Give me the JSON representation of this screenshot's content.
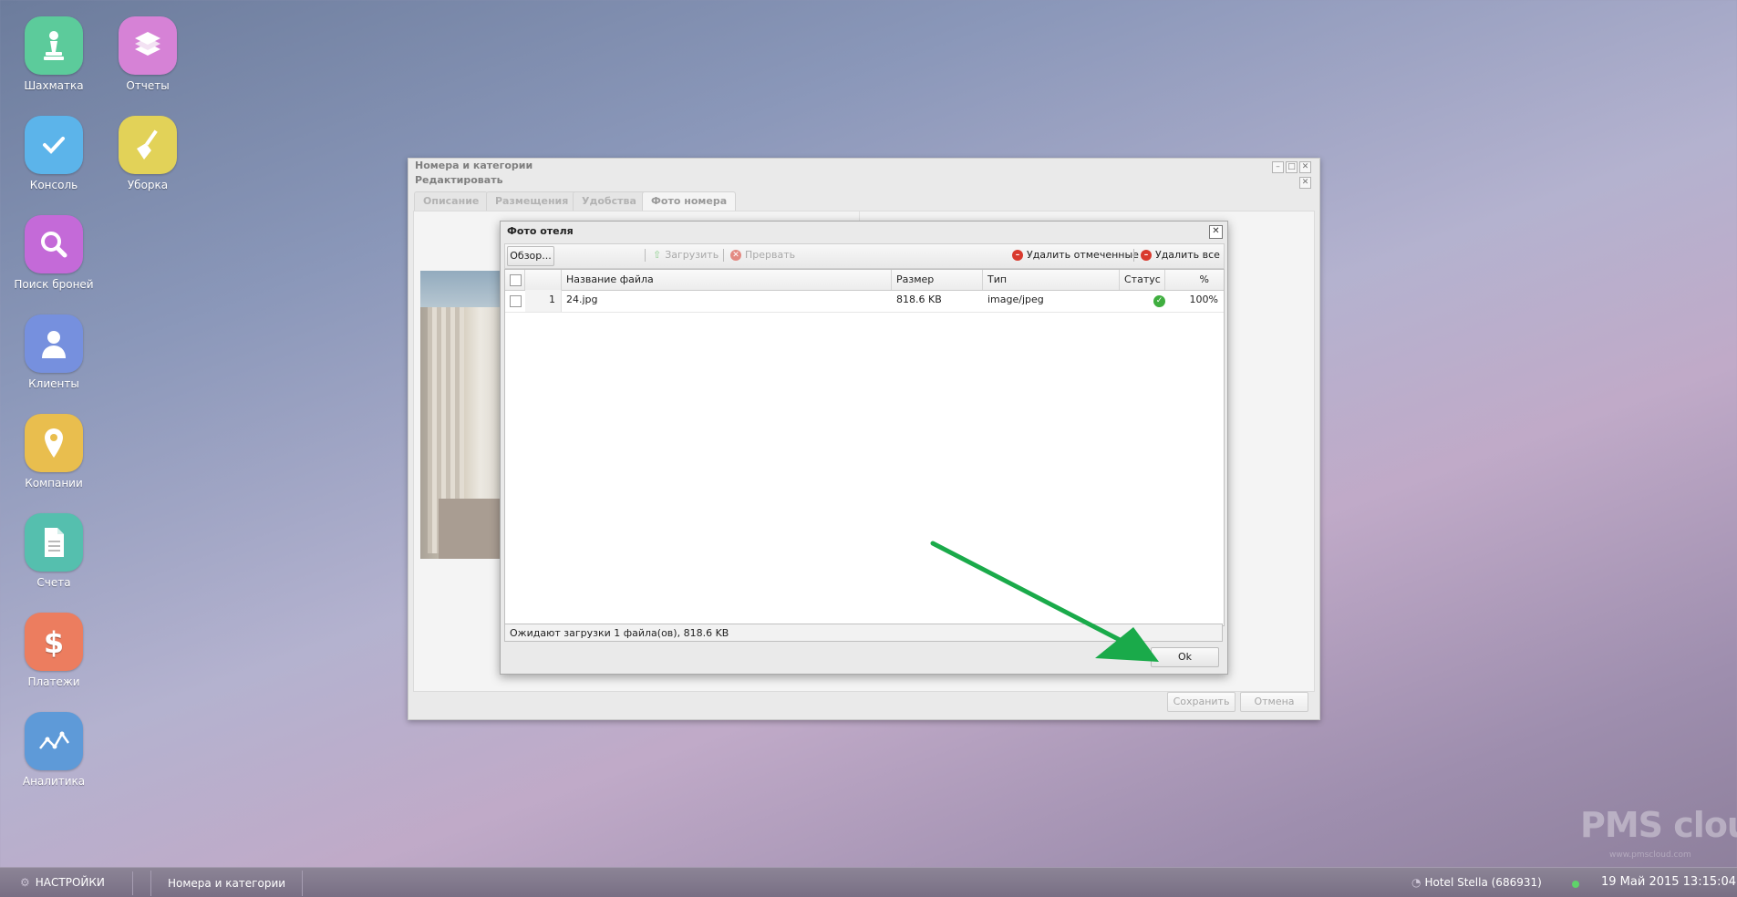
{
  "desktop": {
    "icons": [
      {
        "label": "Шахматка",
        "icon": "chess-pawn-icon",
        "color": "#5ccb9b"
      },
      {
        "label": "Отчеты",
        "icon": "stack-icon",
        "color": "#d682d6"
      },
      {
        "label": "Консоль",
        "icon": "check-icon",
        "color": "#5cb4ea"
      },
      {
        "label": "Уборка",
        "icon": "broom-icon",
        "color": "#e2d258"
      },
      {
        "label": "Поиск броней",
        "icon": "search-icon",
        "color": "#c46ad8"
      },
      {
        "label": "Клиенты",
        "icon": "user-icon",
        "color": "#7690de"
      },
      {
        "label": "Компании",
        "icon": "location-pin-icon",
        "color": "#e9be4e"
      },
      {
        "label": "Счета",
        "icon": "document-icon",
        "color": "#55bfae"
      },
      {
        "label": "Платежи",
        "icon": "dollar-icon",
        "color": "#ec7d5f"
      },
      {
        "label": "Аналитика",
        "icon": "chart-icon",
        "color": "#5e9ad8"
      }
    ]
  },
  "rooms_window": {
    "title": "Номера и категории"
  },
  "edit_window": {
    "title": "Редактировать",
    "tabs": [
      "Описание",
      "Размещения",
      "Удобства",
      "Фото номера"
    ],
    "save_label": "Сохранить",
    "cancel_label": "Отмена"
  },
  "photo_dialog": {
    "title": "Фото отеля",
    "browse_label": "Обзор...",
    "upload_label": "Загрузить",
    "abort_label": "Прервать",
    "delete_checked_label": "Удалить отмеченные",
    "delete_all_label": "Удалить все",
    "columns": [
      "Название файла",
      "Размер",
      "Тип",
      "Статус",
      "%"
    ],
    "rows": [
      {
        "num": "1",
        "name": "24.jpg",
        "size": "818.6 KB",
        "type": "image/jpeg",
        "status": "ok",
        "percent": "100%"
      }
    ],
    "status_text": "Ожидают загрузки 1 файла(ов), 818.6 KB",
    "ok_label": "Ok"
  },
  "watermark": {
    "brand": "PMS cloud",
    "sub": "www.pmscloud.com"
  },
  "taskbar": {
    "settings_label": "НАСТРОЙКИ",
    "task_label": "Номера и категории",
    "hotel": "Hotel Stella (686931)",
    "datetime": "19 Май 2015 13:15:04"
  },
  "colors": {
    "accent_arrow": "#1aaa4a",
    "status_ok": "#3fae3f"
  }
}
